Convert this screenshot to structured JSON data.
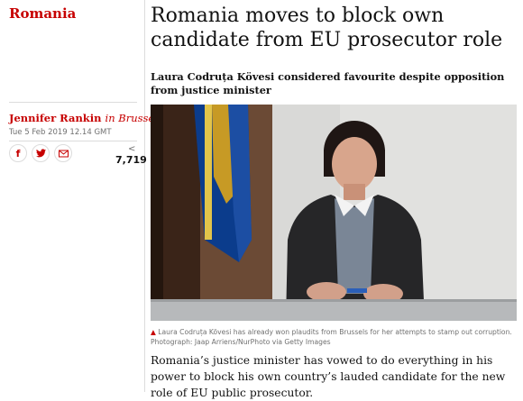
{
  "section": "Romania",
  "headline": "Romania moves to block own candidate from EU prosecutor role",
  "standfirst": "Laura Codruța Kövesi considered favourite despite opposition from justice minister",
  "byline": {
    "author": "Jennifer Rankin",
    "location": "in Brussels"
  },
  "date": "Tue 5 Feb 2019 12.14 GMT",
  "share": {
    "facebook_icon": "f",
    "twitter_icon": "twitter-bird",
    "email_icon": "envelope",
    "count_icon": "<",
    "count": "7,719"
  },
  "photo": {
    "alt": "photo-of-laura-codruta-kovesi"
  },
  "caption": {
    "marker": "▲",
    "text": "Laura Codruța Kövesi has already won plaudits from Brussels for her attempts to stamp out corruption. Photograph: Jaap Arriens/NurPhoto via Getty Images"
  },
  "body": "Romania’s justice minister has vowed to do everything in his power to block his own country’s lauded candidate for the new role of EU public prosecutor.",
  "colors": {
    "accent": "#c70000",
    "text": "#121212",
    "muted": "#707070",
    "rule": "#dcdcdc"
  }
}
